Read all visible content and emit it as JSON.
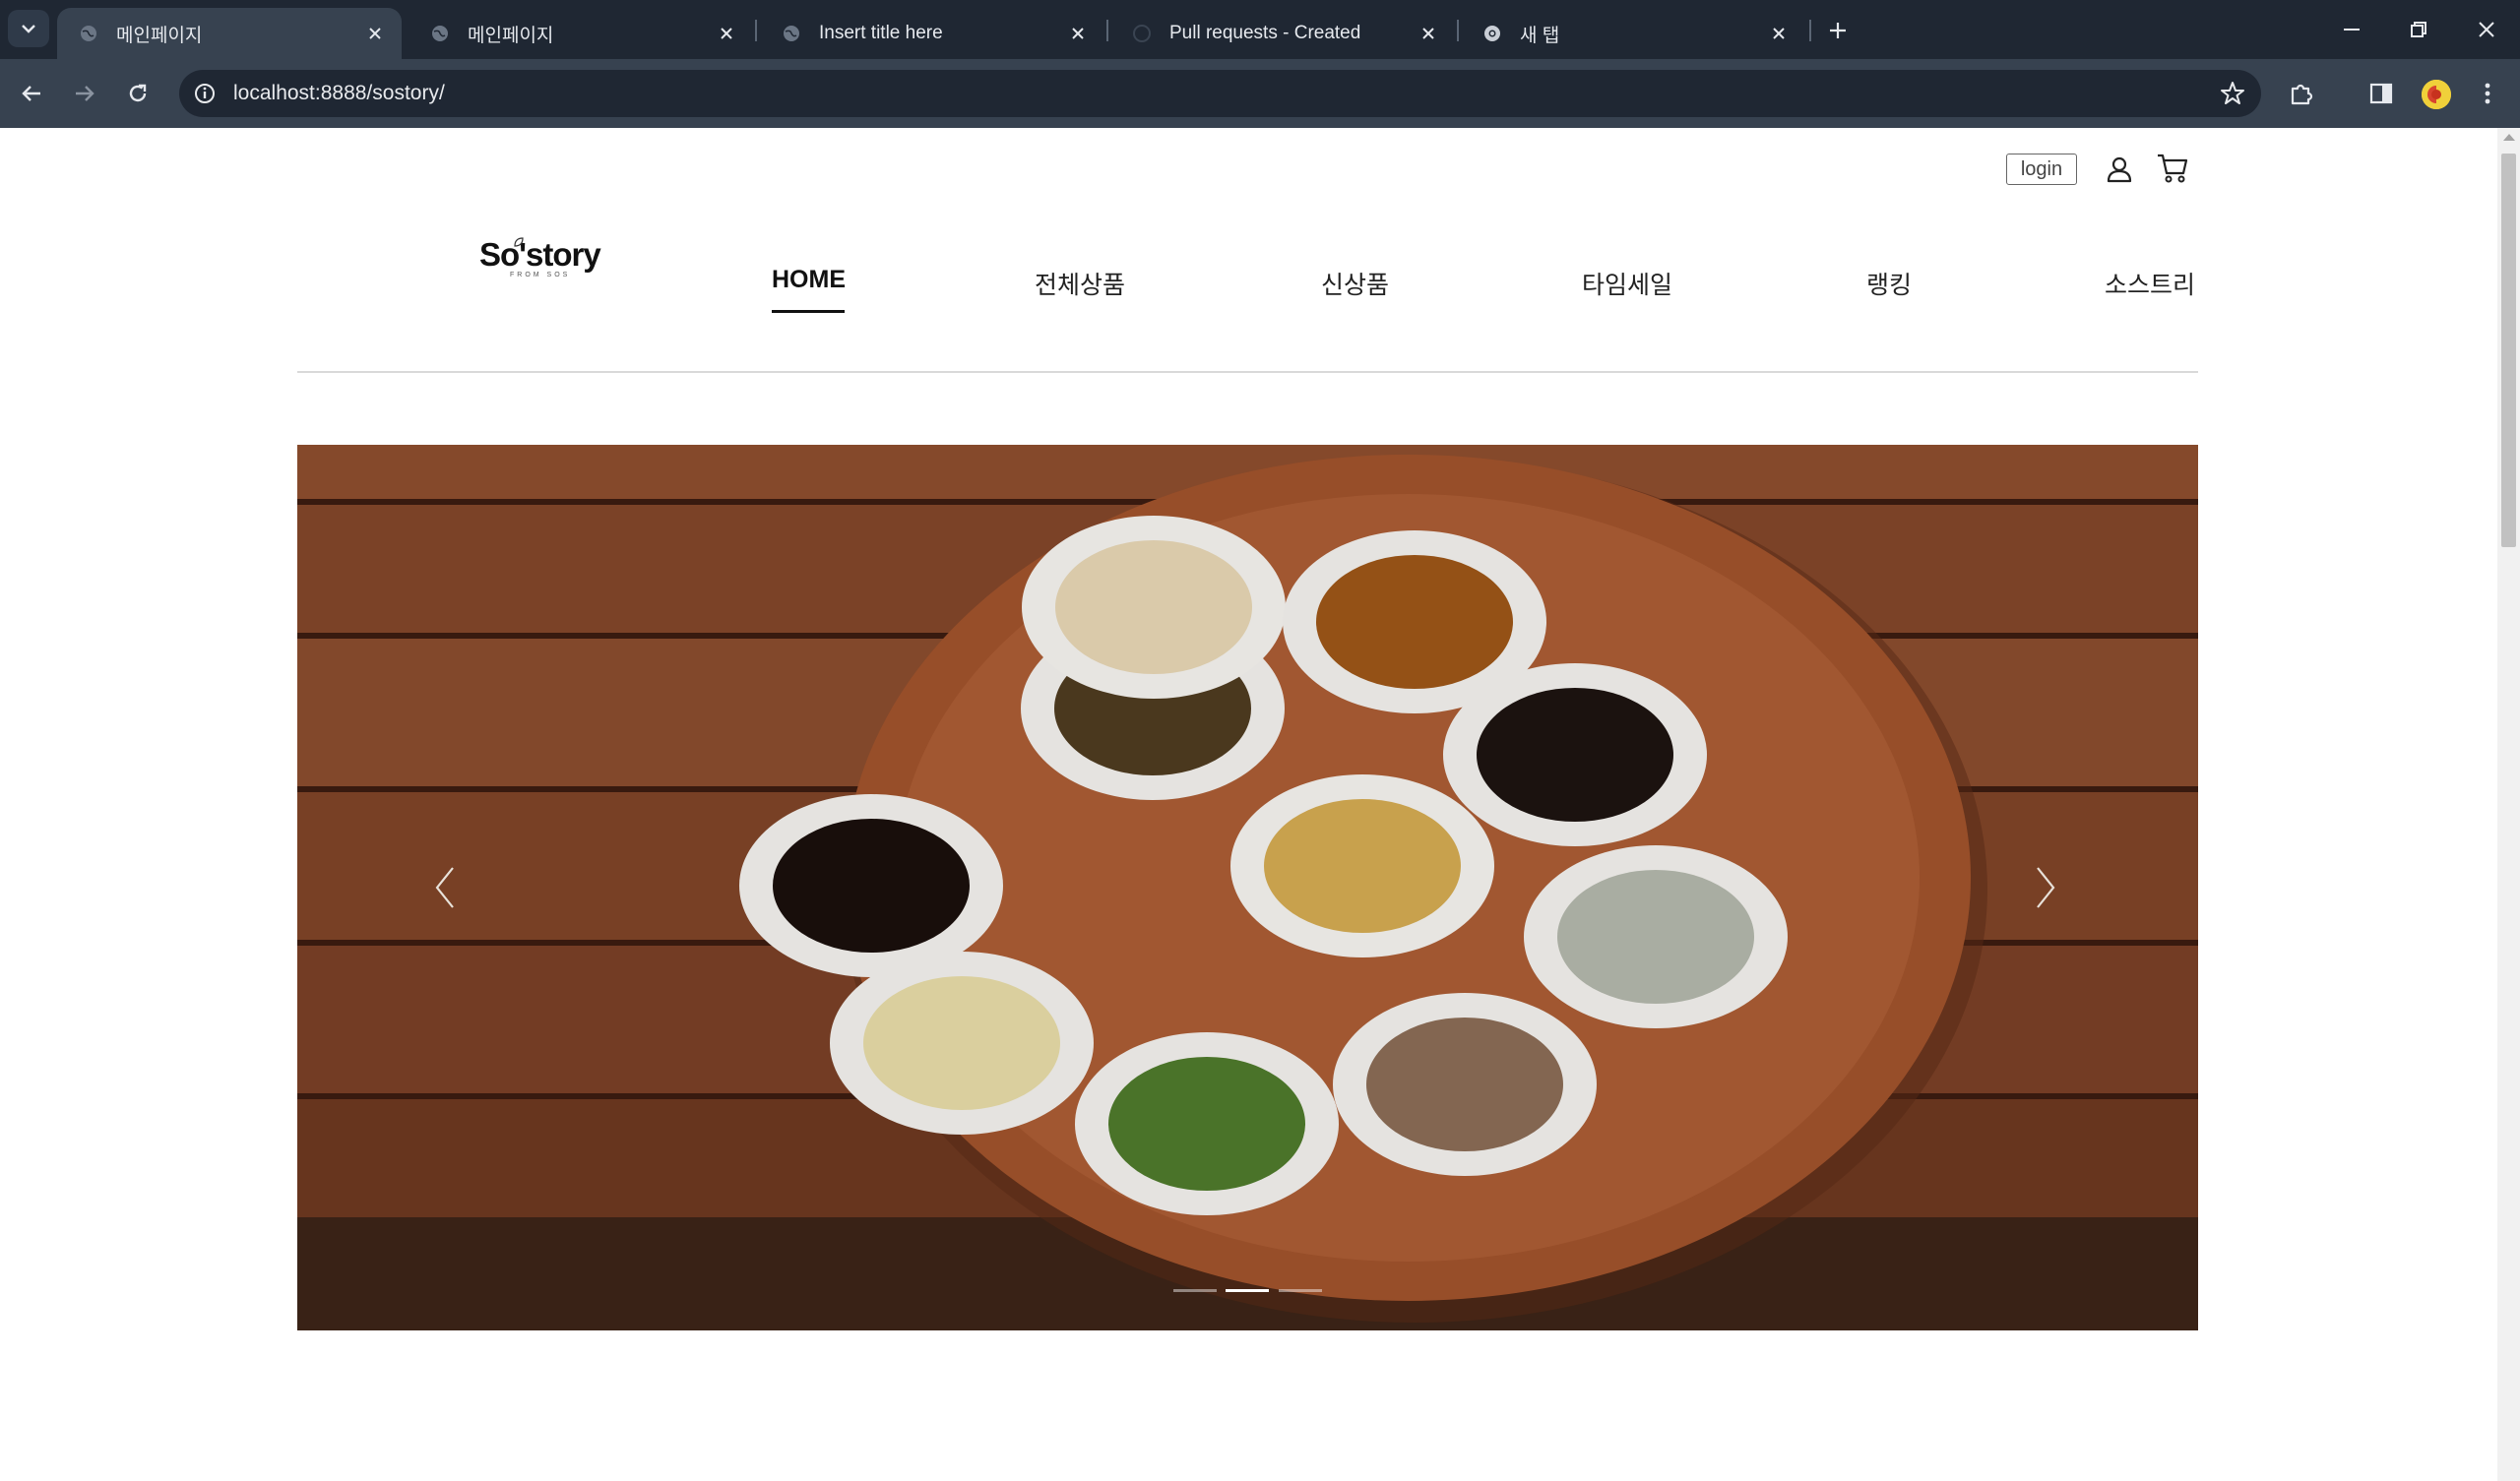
{
  "browser": {
    "tabs": [
      {
        "title": "메인페이지",
        "active": true
      },
      {
        "title": "메인페이지",
        "active": false
      },
      {
        "title": "Insert title here",
        "active": false
      },
      {
        "title": "Pull requests - Created",
        "active": false
      },
      {
        "title": "새 탭",
        "active": false
      }
    ],
    "address": "localhost:8888/sostory/",
    "icons": [
      "tab-search-icon",
      "back-arrow-icon",
      "forward-arrow-icon",
      "reload-icon",
      "site-info-icon",
      "bookmark-star-icon",
      "extensions-icon",
      "side-panel-icon",
      "profile-avatar-icon",
      "more-menu-icon",
      "minimize-icon",
      "restore-icon",
      "close-window-icon"
    ]
  },
  "header": {
    "login_label": "login",
    "logo_text": "So'story",
    "logo_sub": "FROM SOS",
    "menu": [
      {
        "label": "HOME",
        "active": true
      },
      {
        "label": "전체상품",
        "active": false
      },
      {
        "label": "신상품",
        "active": false
      },
      {
        "label": "타임세일",
        "active": false
      },
      {
        "label": "랭킹",
        "active": false
      },
      {
        "label": "소스트리",
        "active": false
      }
    ]
  },
  "carousel": {
    "slide_count": 3,
    "active_slide": 2,
    "icons": [
      "prev-arrow-icon",
      "next-arrow-icon"
    ]
  },
  "colors": {
    "chrome_dark": "#1f2733",
    "chrome_mid": "#374250",
    "accent_underline": "#111111"
  }
}
